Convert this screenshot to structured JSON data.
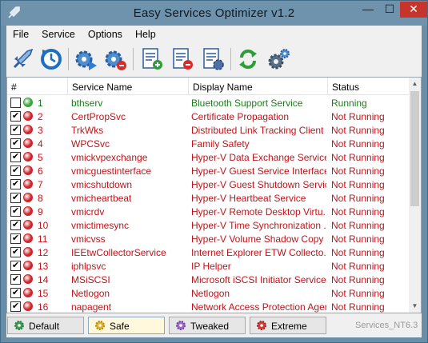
{
  "window": {
    "title": "Easy Services Optimizer v1.2",
    "controls": {
      "minimize": "—",
      "maximize": "☐",
      "close": "✕"
    }
  },
  "menu": [
    "File",
    "Service",
    "Options",
    "Help"
  ],
  "toolbar": {
    "icons": [
      "rocket-icon",
      "restore-icon",
      "start-service-icon",
      "stop-service-icon",
      "add-list-icon",
      "remove-list-icon",
      "edit-list-icon",
      "refresh-icon",
      "settings-gears-icon"
    ]
  },
  "columns": {
    "num": "#",
    "service_name": "Service Name",
    "display_name": "Display Name",
    "status": "Status"
  },
  "rows": [
    {
      "checked": false,
      "state": "green",
      "num": "1",
      "service": "bthserv",
      "display": "Bluetooth Support Service",
      "status": "Running"
    },
    {
      "checked": true,
      "state": "red",
      "num": "2",
      "service": "CertPropSvc",
      "display": "Certificate Propagation",
      "status": "Not Running"
    },
    {
      "checked": true,
      "state": "red",
      "num": "3",
      "service": "TrkWks",
      "display": "Distributed Link Tracking Client",
      "status": "Not Running"
    },
    {
      "checked": true,
      "state": "red",
      "num": "4",
      "service": "WPCSvc",
      "display": "Family Safety",
      "status": "Not Running"
    },
    {
      "checked": true,
      "state": "red",
      "num": "5",
      "service": "vmickvpexchange",
      "display": "Hyper-V Data Exchange Service",
      "status": "Not Running"
    },
    {
      "checked": true,
      "state": "red",
      "num": "6",
      "service": "vmicguestinterface",
      "display": "Hyper-V Guest Service Interface",
      "status": "Not Running"
    },
    {
      "checked": true,
      "state": "red",
      "num": "7",
      "service": "vmicshutdown",
      "display": "Hyper-V Guest Shutdown Service",
      "status": "Not Running"
    },
    {
      "checked": true,
      "state": "red",
      "num": "8",
      "service": "vmicheartbeat",
      "display": "Hyper-V Heartbeat Service",
      "status": "Not Running"
    },
    {
      "checked": true,
      "state": "red",
      "num": "9",
      "service": "vmicrdv",
      "display": "Hyper-V Remote Desktop Virtu...",
      "status": "Not Running"
    },
    {
      "checked": true,
      "state": "red",
      "num": "10",
      "service": "vmictimesync",
      "display": "Hyper-V Time Synchronization ...",
      "status": "Not Running"
    },
    {
      "checked": true,
      "state": "red",
      "num": "11",
      "service": "vmicvss",
      "display": "Hyper-V Volume Shadow Copy ...",
      "status": "Not Running"
    },
    {
      "checked": true,
      "state": "red",
      "num": "12",
      "service": "IEEtwCollectorService",
      "display": "Internet Explorer ETW Collecto...",
      "status": "Not Running"
    },
    {
      "checked": true,
      "state": "red",
      "num": "13",
      "service": "iphlpsvc",
      "display": "IP Helper",
      "status": "Not Running"
    },
    {
      "checked": true,
      "state": "red",
      "num": "14",
      "service": "MSiSCSI",
      "display": "Microsoft iSCSI Initiator Service",
      "status": "Not Running"
    },
    {
      "checked": true,
      "state": "red",
      "num": "15",
      "service": "Netlogon",
      "display": "Netlogon",
      "status": "Not Running"
    },
    {
      "checked": true,
      "state": "red",
      "num": "16",
      "service": "napagent",
      "display": "Network Access Protection Agent",
      "status": "Not Running"
    }
  ],
  "presets": {
    "default": "Default",
    "safe": "Safe",
    "tweaked": "Tweaked",
    "extreme": "Extreme",
    "active": "safe"
  },
  "os_label": "Services_NT6.3",
  "colors": {
    "running_text": "#1f7a1f",
    "not_running_text": "#c0141a",
    "green_dot": "#3aa63a",
    "red_dot": "#d2232a",
    "titlebar": "#6f93ad"
  }
}
